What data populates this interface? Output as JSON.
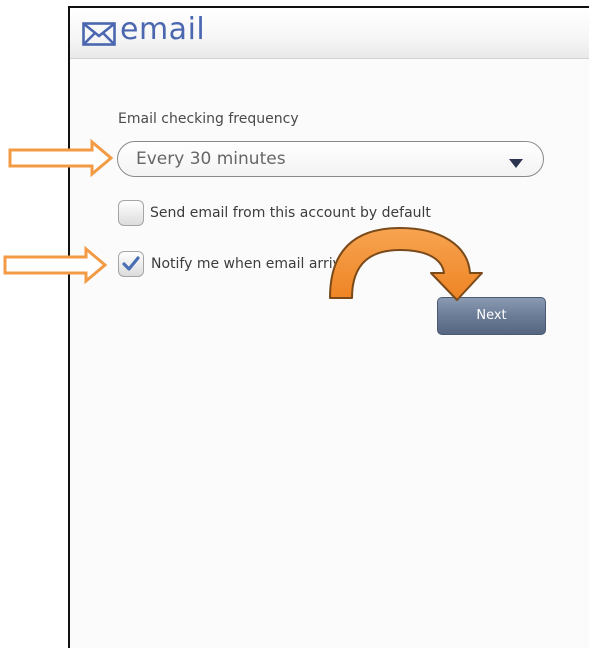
{
  "header": {
    "title": "email",
    "icon": "envelope-icon"
  },
  "form": {
    "frequency_label": "Email checking frequency",
    "frequency_value": "Every 30 minutes",
    "send_email_label": "Send email from this account by default",
    "send_email_checked": false,
    "notify_label": "Notify me when email arrives.",
    "notify_checked": true,
    "next_label": "Next"
  },
  "annotations": {
    "arrow_color": "#f39a45",
    "curved_arrow_color": "#f08a2a",
    "arrows": [
      "right-arrow-frequency",
      "right-arrow-notify",
      "curved-arrow-next"
    ]
  },
  "colors": {
    "accent": "#4b67b0",
    "button": "#6b7c97",
    "check": "#4a6fb5"
  }
}
